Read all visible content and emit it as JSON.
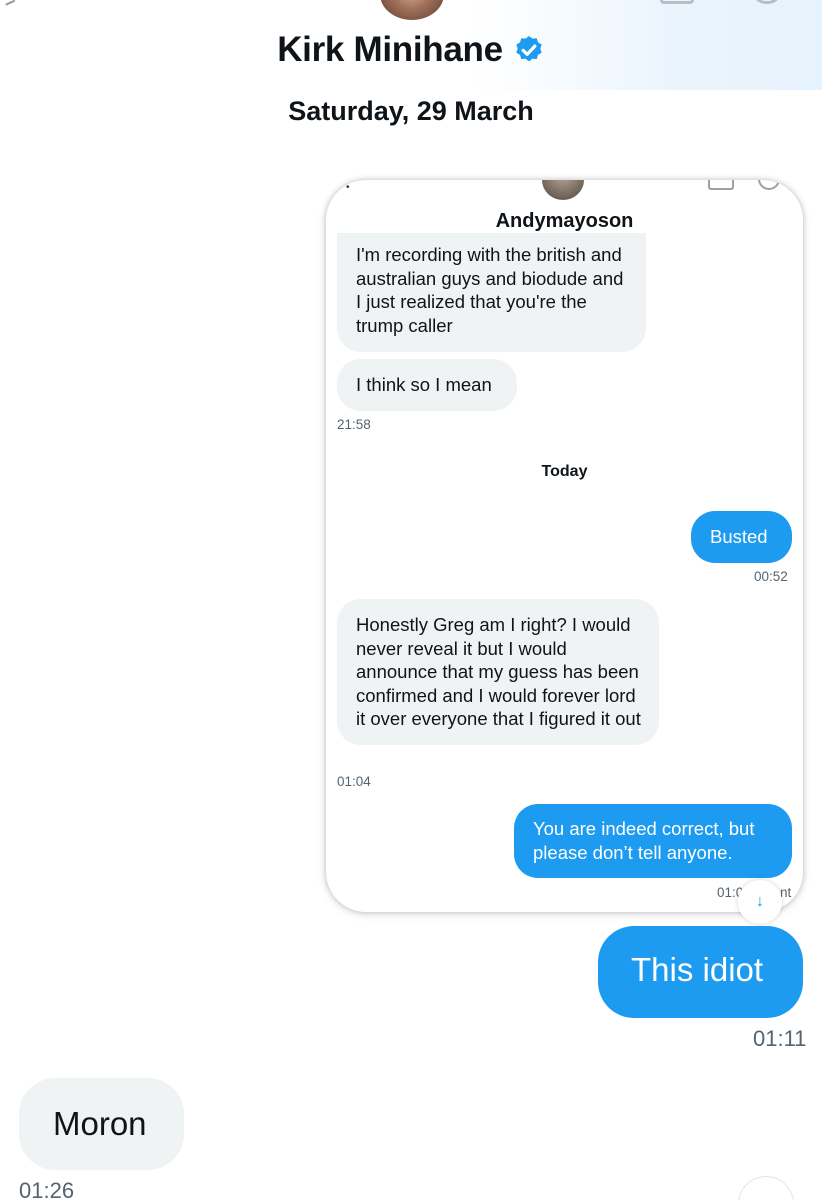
{
  "header": {
    "contact_name": "Kirk Minihane",
    "date": "Saturday, 29 March"
  },
  "embedded_screenshot": {
    "contact_name": "Andymayoson",
    "messages": [
      {
        "direction": "in",
        "text": "I'm recording with the british and australian guys and biodude and I just realized that you're the trump caller"
      },
      {
        "direction": "in",
        "text": "I think so I mean",
        "time": "21:58"
      },
      {
        "direction": "out",
        "text": "Busted",
        "time": "00:52"
      },
      {
        "direction": "in",
        "text": "Honestly Greg am I right? I would never reveal it but I would announce that my guess has been confirmed and I would forever lord it over everyone that I figured it out",
        "time": "01:04"
      },
      {
        "direction": "out",
        "text": "You are indeed correct, but please don’t tell anyone.",
        "time": "01:0"
      }
    ],
    "day_separator": "Today",
    "partial_status": "nt"
  },
  "messages": [
    {
      "direction": "out",
      "text": "This idiot",
      "time": "01:11"
    },
    {
      "direction": "in",
      "text": "Moron",
      "time": "01:26"
    }
  ],
  "colors": {
    "accent": "#1d9bf0",
    "incoming_bubble": "#eff3f4",
    "timestamp": "#536471"
  }
}
